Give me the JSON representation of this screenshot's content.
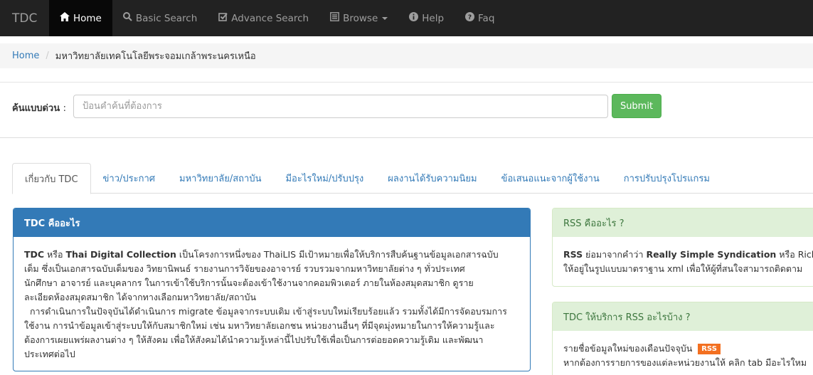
{
  "navbar": {
    "brand": "TDC",
    "items": [
      {
        "label": "Home",
        "icon": "home-icon"
      },
      {
        "label": "Basic Search",
        "icon": "search-icon"
      },
      {
        "label": "Advance Search",
        "icon": "edit-check-icon"
      },
      {
        "label": "Browse",
        "icon": "list-icon"
      },
      {
        "label": "Help",
        "icon": "info-icon"
      },
      {
        "label": "Faq",
        "icon": "question-icon"
      }
    ]
  },
  "breadcrumb": {
    "home": "Home",
    "separator": "/",
    "current": "มหาวิทยาลัยเทคโนโลยีพระจอมเกล้าพระนครเหนือ"
  },
  "search": {
    "label": "ค้นแบบด่วน",
    "colon": ":",
    "placeholder": "ป้อนคำค้นที่ต้องการ",
    "submit_label": "Submit"
  },
  "tabs": [
    {
      "label": "เกี่ยวกับ TDC"
    },
    {
      "label": "ข่าว/ประกาศ"
    },
    {
      "label": "มหาวิทยาลัย/สถาบัน"
    },
    {
      "label": "มีอะไรใหม่/ปรับปรุง"
    },
    {
      "label": "ผลงานได้รับความนิยม"
    },
    {
      "label": "ข้อเสนอแนะจากผู้ใช้งาน"
    },
    {
      "label": "การปรับปรุงโปรแกรม"
    }
  ],
  "about_panel": {
    "title": "TDC คืออะไร",
    "p1_tdc": "TDC",
    "p1_or": " หรือ ",
    "p1_name": "Thai Digital Collection",
    "p1_line1": " เป็นโครงการหนึ่งของ ThaiLIS มีเป้าหมายเพื่อให้บริการสืบค้นฐานข้อมูลเอกสารฉบับ",
    "p1_line2": "เต็ม ซึ่งเป็นเอกสารฉบับเต็มของ วิทยานิพนธ์ รายงานการวิจัยของอาจารย์ รวบรวมจากมหาวิทยาลัยต่าง ๆ ทั่วประเทศ",
    "p1_line3": "นักศึกษา อาจารย์ และบุคลากร ในการเข้าใช้บริการนั้นจะต้องเข้าใช้งานจากคอมพิวเตอร์ ภายในห้องสมุดสมาชิก ดูราย",
    "p1_line4": "ละเอียดห้องสมุดสมาชิก ได้จากทางเลือกมหาวิทยาลัย/สถาบัน",
    "p2_line1": "  การดำเนินการในปัจจุบันได้ดำเนินการ migrate ข้อมูลจากระบบเดิม เข้าสู่ระบบใหม่เรียบร้อยแล้ว รวมทั้งได้มีการจัดอบรมการ",
    "p2_line2": "ใช้งาน การนำข้อมูลเข้าสู่ระบบให้กับสมาชิกใหม่ เช่น มหาวิทยาลัยเอกชน หน่วยงานอื่นๆ ที่มีจุดมุ่งหมายในการให้ความรู้และ",
    "p2_line3": "ต้องการเผยแพร่ผลงานต่าง ๆ ให้สังคม เพื่อให้สังคมได้นำความรู้เหล่านี้ไปปรับใช้เพื่อเป็นการต่อยอดความรู้เดิม และพัฒนา",
    "p2_line4": "ประเทศต่อไป"
  },
  "rss_panel": {
    "title": "RSS คืออะไร ?",
    "rss": "RSS",
    "text1": " ย่อมาจากคำว่า ",
    "full": "Really Simple Syndication",
    "text2": " หรือ Rich",
    "line2": "ให้อยู่ในรูปแบบมาตราฐาน xml เพื่อให้ผู้ที่สนใจสามารถติดตาม"
  },
  "tdc_rss_panel": {
    "title": "TDC ให้บริการ RSS อะไรบ้าง ?",
    "line1": "รายชื่อข้อมูลใหม่ของเดือนปัจจุบัน",
    "badge": "RSS",
    "line2": "หากต้องการรายการของแต่ละหน่วยงานให้ คลิก tab มีอะไรใหม"
  },
  "colors": {
    "navbar_bg": "#222222",
    "active_nav": "#080808",
    "link": "#337ab7",
    "success": "#5cb85c",
    "rss_orange": "#f37021"
  }
}
